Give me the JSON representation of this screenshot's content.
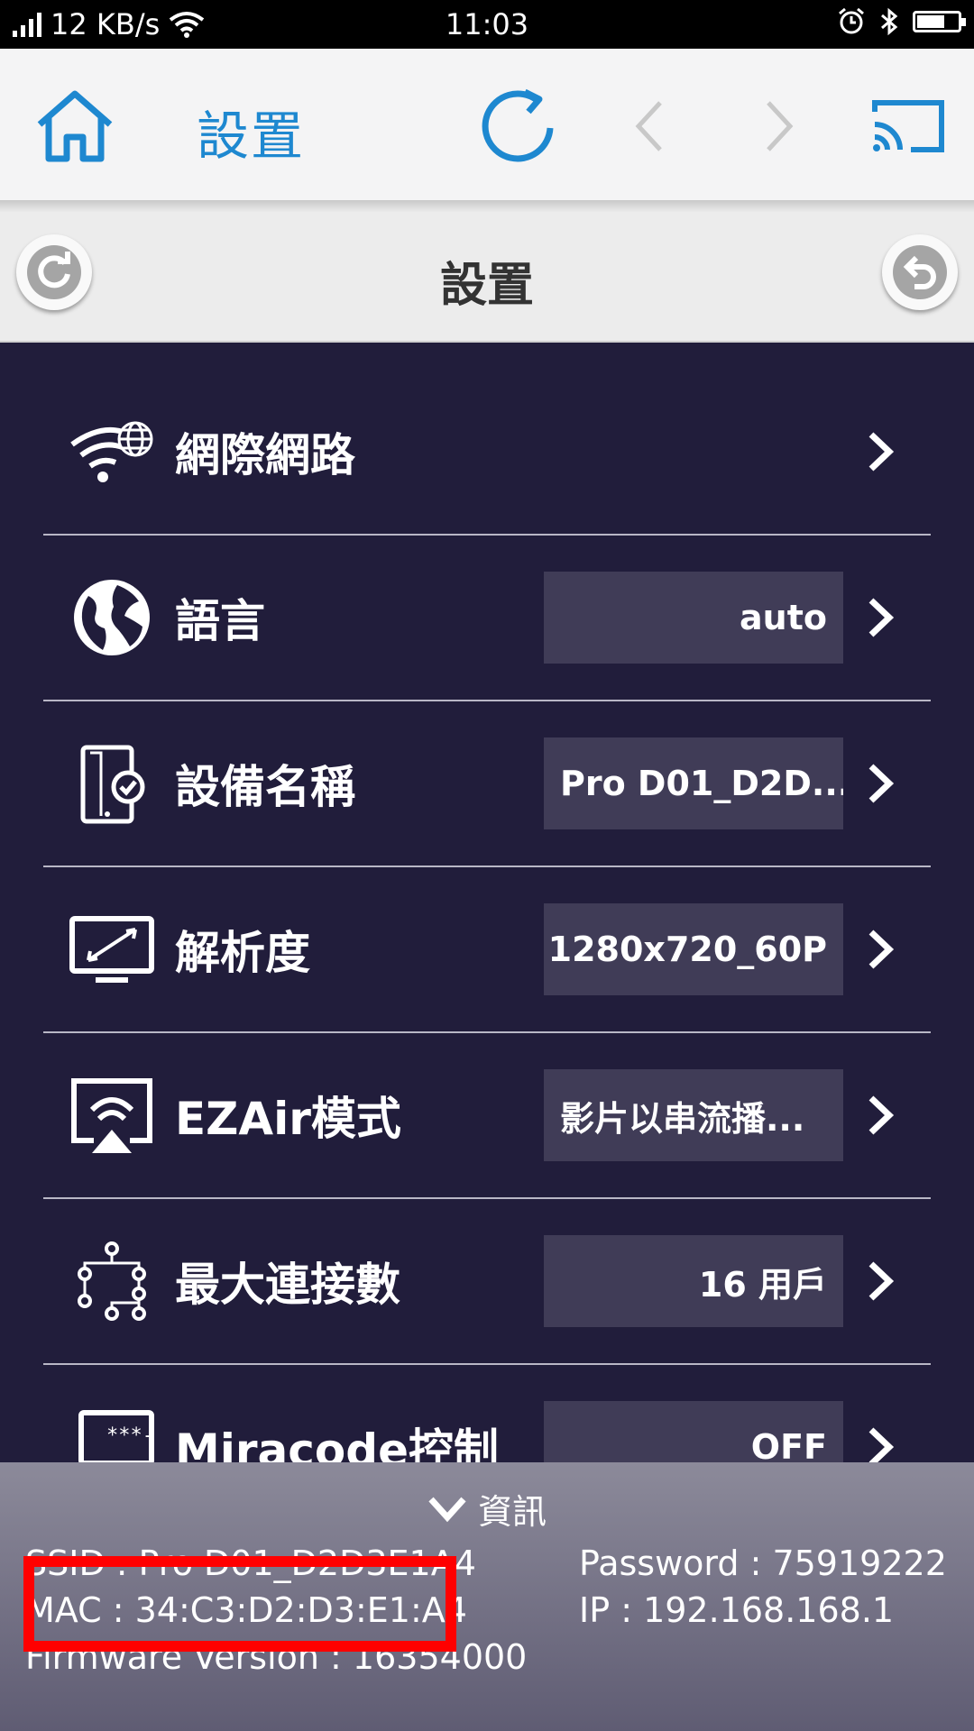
{
  "status_bar": {
    "speed": "12 KB/s",
    "time": "11:03"
  },
  "app_bar": {
    "title": "設置"
  },
  "page_header": {
    "title": "設置"
  },
  "settings": [
    {
      "label": "網際網路",
      "value": null,
      "icon": "wifi-globe-icon"
    },
    {
      "label": "語言",
      "value": "auto",
      "icon": "globe-icon"
    },
    {
      "label": "設備名稱",
      "value": "Pro D01_D2D...",
      "icon": "device-check-icon"
    },
    {
      "label": "解析度",
      "value": "1280x720_60P",
      "icon": "monitor-resolution-icon"
    },
    {
      "label": "EZAir模式",
      "value": "影片以串流播...",
      "icon": "airplay-icon"
    },
    {
      "label": "最大連接數",
      "value": "16 用戶",
      "icon": "network-tree-icon"
    },
    {
      "label": "Miracode控制",
      "value": "OFF",
      "icon": "miracode-gear-icon"
    }
  ],
  "info": {
    "header": "資訊",
    "ssid": "SSID : Pro D01_D2D3E1A4",
    "mac": "MAC : 34:C3:D2:D3:E1:A4",
    "firmware": "Firmware Version : 16354000",
    "password": "Password : 75919222",
    "ip": "IP : 192.168.168.1"
  },
  "colors": {
    "accent": "#1e88d0",
    "list_bg": "#211d3b",
    "value_bg": "#403c57",
    "highlight": "#ff0000"
  }
}
